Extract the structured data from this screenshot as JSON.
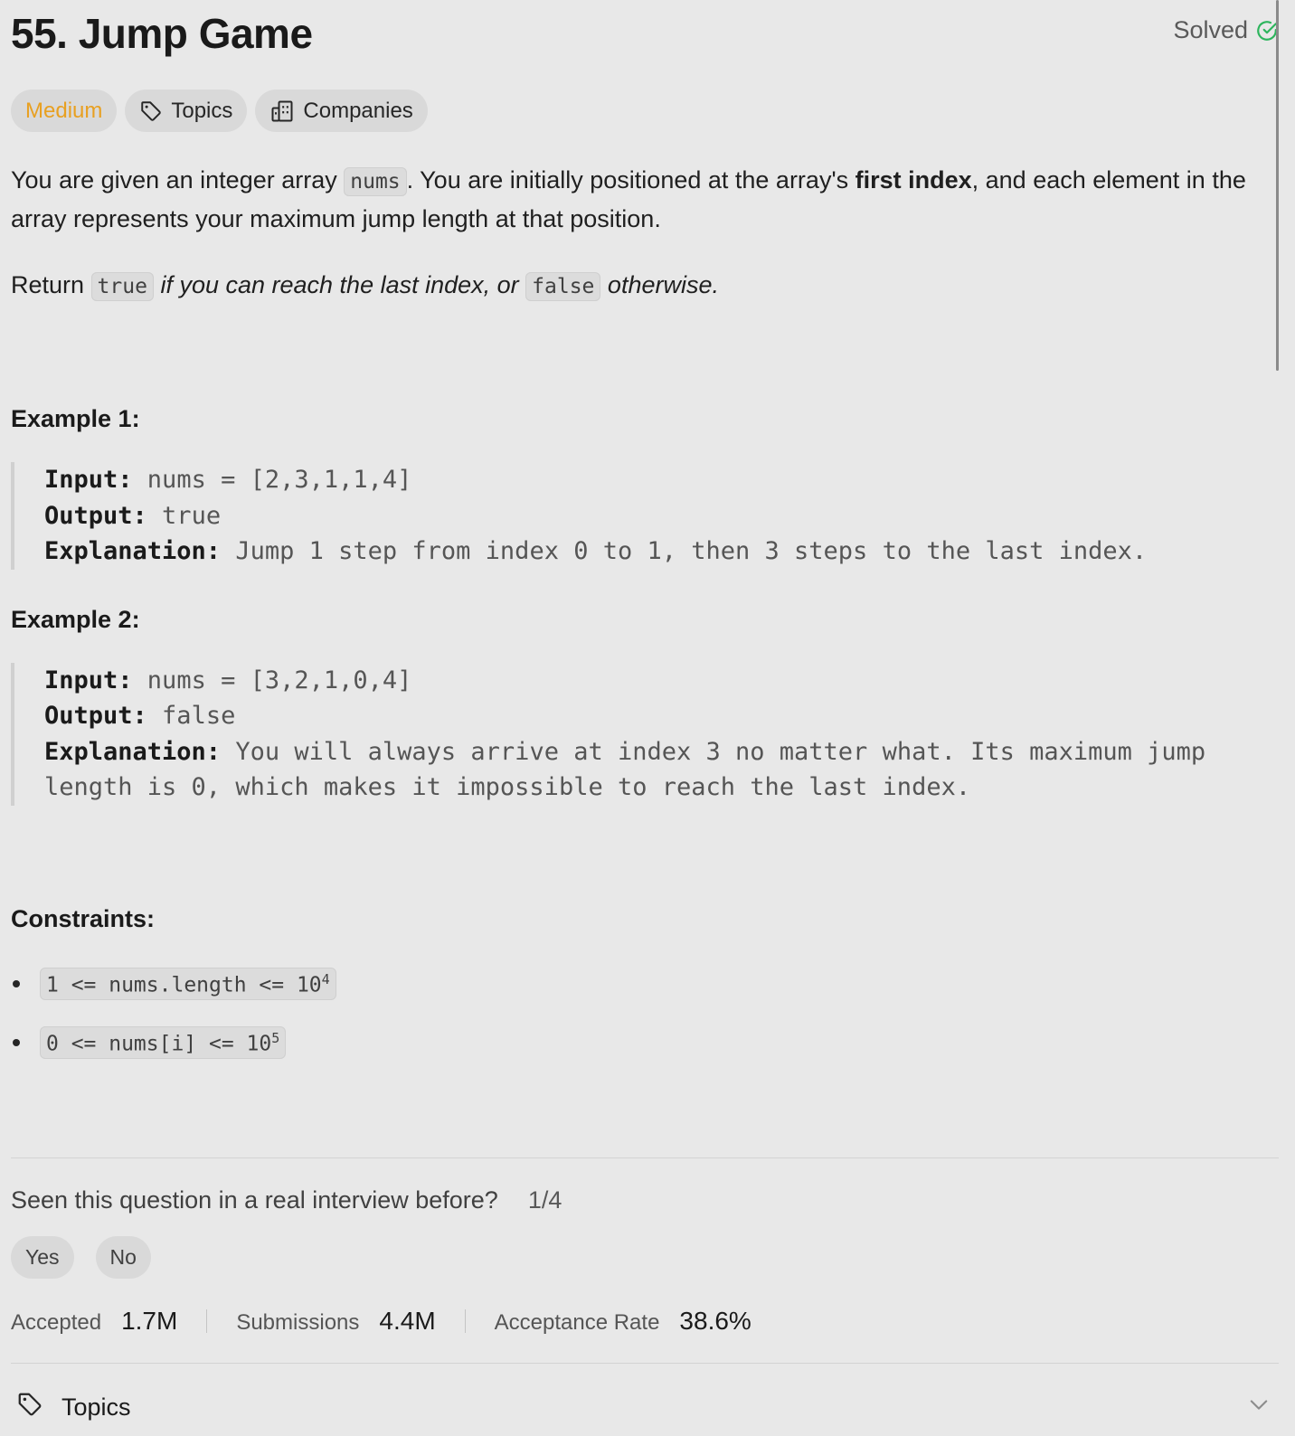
{
  "problem": {
    "title": "55. Jump Game",
    "status": "Solved",
    "tags": {
      "difficulty": "Medium",
      "topics": "Topics",
      "companies": "Companies"
    }
  },
  "description": {
    "p1_a": "You are given an integer array ",
    "p1_code": "nums",
    "p1_b": ". You are initially positioned at the array's ",
    "p1_bold": "first index",
    "p1_c": ", and each element in the array represents your maximum jump length at that position.",
    "p2_a": "Return ",
    "p2_code1": "true",
    "p2_i1": " if you can reach the last index, or ",
    "p2_code2": "false",
    "p2_i2": " otherwise."
  },
  "examples": [
    {
      "title": "Example 1:",
      "input_label": "Input:",
      "input": " nums = [2,3,1,1,4]",
      "output_label": "Output:",
      "output": " true",
      "explanation_label": "Explanation:",
      "explanation": " Jump 1 step from index 0 to 1, then 3 steps to the last index."
    },
    {
      "title": "Example 2:",
      "input_label": "Input:",
      "input": " nums = [3,2,1,0,4]",
      "output_label": "Output:",
      "output": " false",
      "explanation_label": "Explanation:",
      "explanation": " You will always arrive at index 3 no matter what. Its maximum jump length is 0, which makes it impossible to reach the last index."
    }
  ],
  "constraints": {
    "title": "Constraints:",
    "items": [
      {
        "text": "1 <= nums.length <= 10",
        "exp": "4"
      },
      {
        "text": "0 <= nums[i] <= 10",
        "exp": "5"
      }
    ]
  },
  "interview": {
    "question": "Seen this question in a real interview before?",
    "count": "1/4",
    "yes": "Yes",
    "no": "No"
  },
  "stats": {
    "accepted_label": "Accepted",
    "accepted_value": "1.7M",
    "submissions_label": "Submissions",
    "submissions_value": "4.4M",
    "rate_label": "Acceptance Rate",
    "rate_value": "38.6%"
  },
  "sections": {
    "topics_label": "Topics"
  },
  "colors": {
    "background": "#e8e8e8",
    "medium": "#e8a021",
    "solved_check": "#2db55d"
  },
  "icons": [
    "check-circle-icon",
    "tag-icon",
    "building-icon",
    "chevron-down-icon"
  ]
}
